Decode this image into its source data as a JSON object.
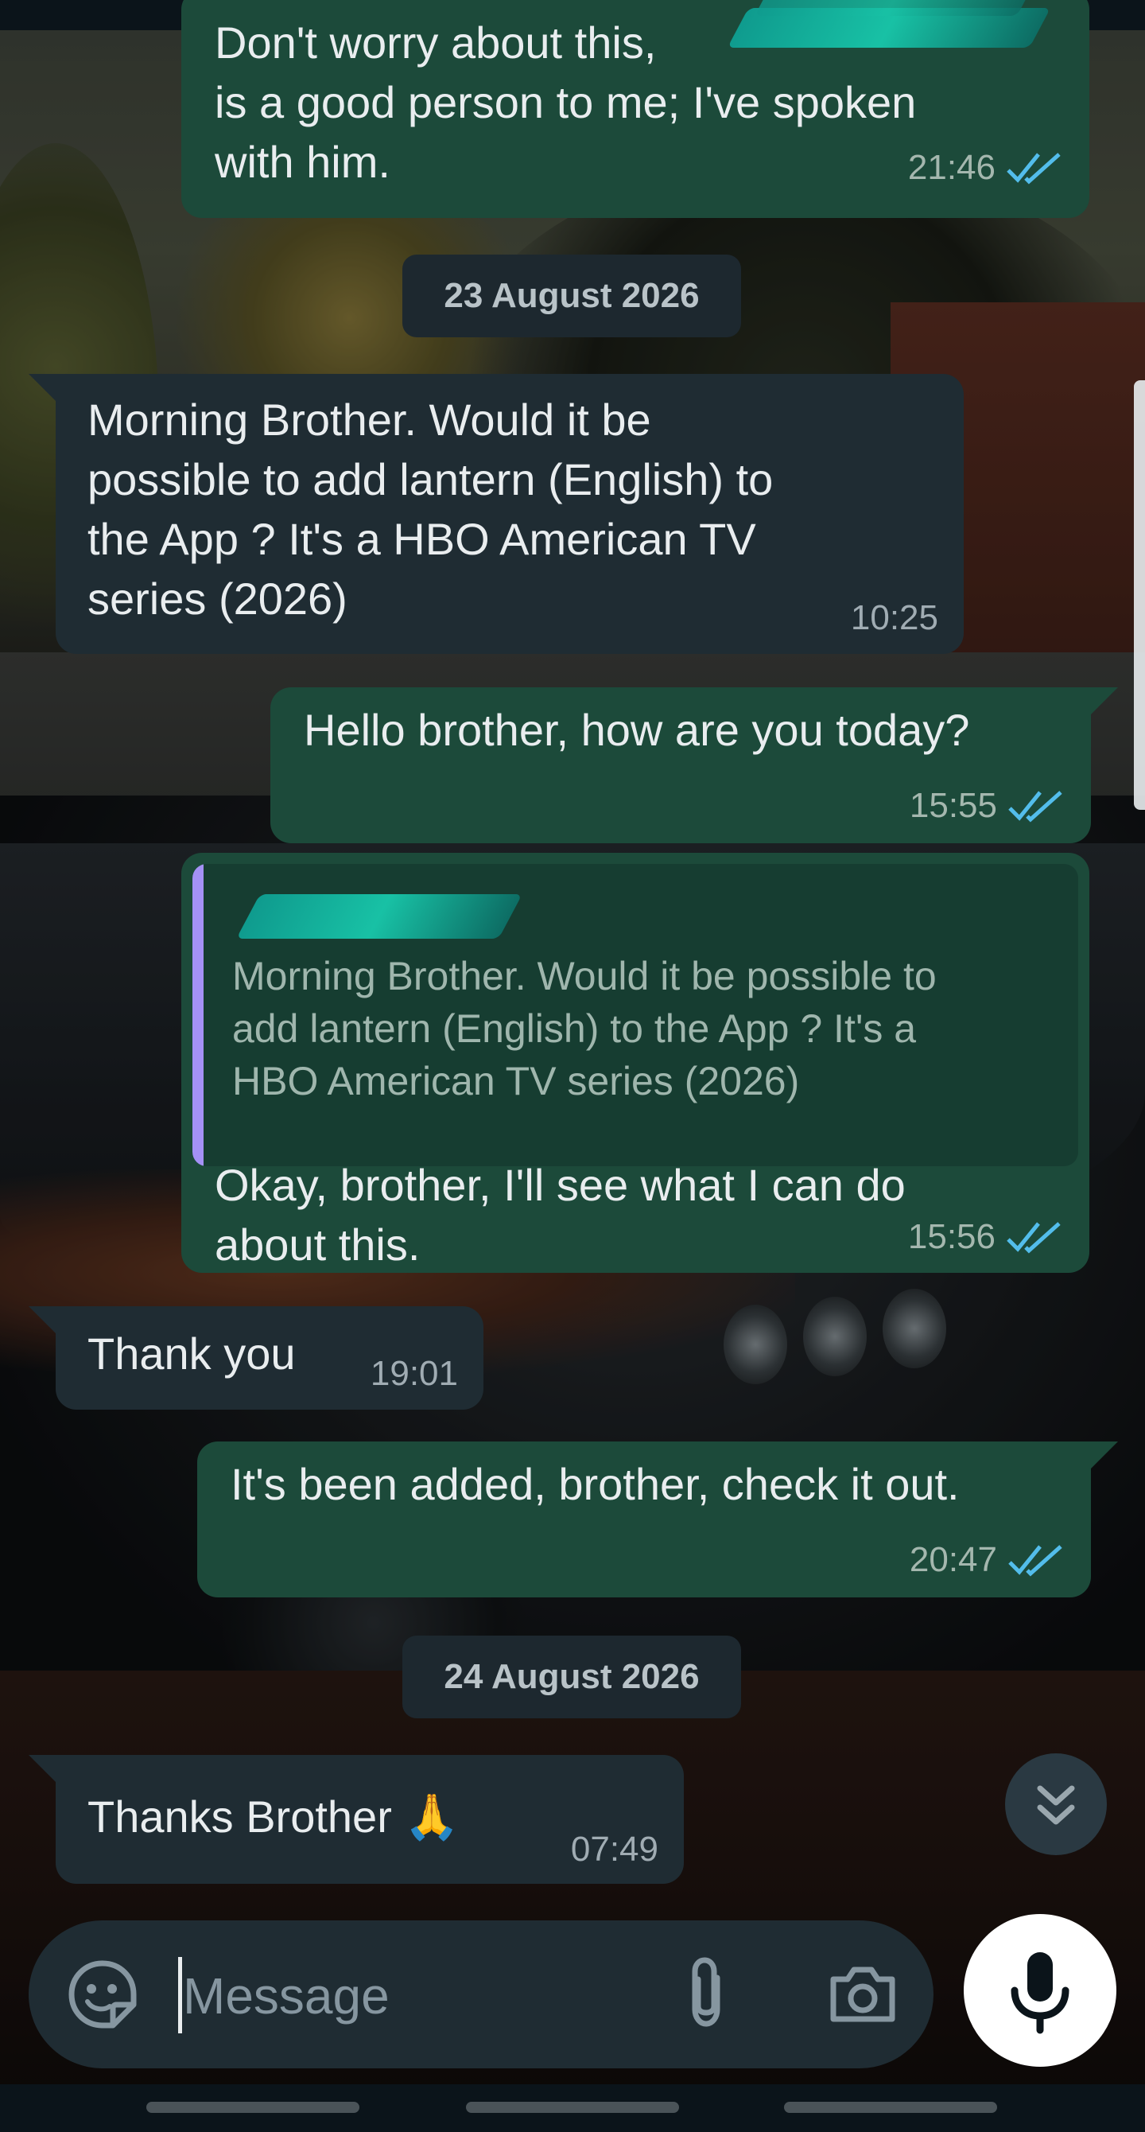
{
  "messages": [
    {
      "id": "m1",
      "direction": "outgoing",
      "lines": [
        "Don't worry about this,",
        "is a good person to me; I've spoken",
        "with him."
      ],
      "time": "21:46",
      "status": "read"
    },
    {
      "id": "m2",
      "direction": "incoming",
      "lines": [
        "Morning Brother. Would it be",
        "possible to add lantern (English) to",
        "the App ? It's a HBO American TV",
        "series (2026)"
      ],
      "time": "10:25"
    },
    {
      "id": "m3",
      "direction": "outgoing",
      "lines": [
        "Hello brother, how are you today?"
      ],
      "time": "15:55",
      "status": "read"
    },
    {
      "id": "m4",
      "direction": "outgoing",
      "quote": {
        "lines": [
          "Morning Brother. Would it be possible to",
          "add lantern (English) to the App ? It's a",
          "HBO American TV series (2026)"
        ]
      },
      "lines": [
        "Okay, brother, I'll see what I can do",
        "about this."
      ],
      "time": "15:56",
      "status": "read"
    },
    {
      "id": "m5",
      "direction": "incoming",
      "lines": [
        "Thank you"
      ],
      "time": "19:01"
    },
    {
      "id": "m6",
      "direction": "outgoing",
      "lines": [
        "It's been added, brother, check it out."
      ],
      "time": "20:47",
      "status": "read"
    },
    {
      "id": "m7",
      "direction": "incoming",
      "lines": [
        "Thanks Brother 🙏"
      ],
      "time": "07:49"
    }
  ],
  "date_separators": [
    "23 August 2026",
    "24 August 2026"
  ],
  "composer": {
    "placeholder": "Message"
  },
  "icons": {
    "emoji": "sticker-icon",
    "attach": "paperclip-icon",
    "camera": "camera-icon",
    "mic": "microphone-icon",
    "scroll": "double-chevron-down-icon",
    "read": "double-check-icon"
  },
  "colors": {
    "outgoing_bubble": "#1c4a3a",
    "incoming_bubble": "#1f2c33",
    "read_tick": "#53bdeb",
    "quote_bar": "#a491f5"
  }
}
